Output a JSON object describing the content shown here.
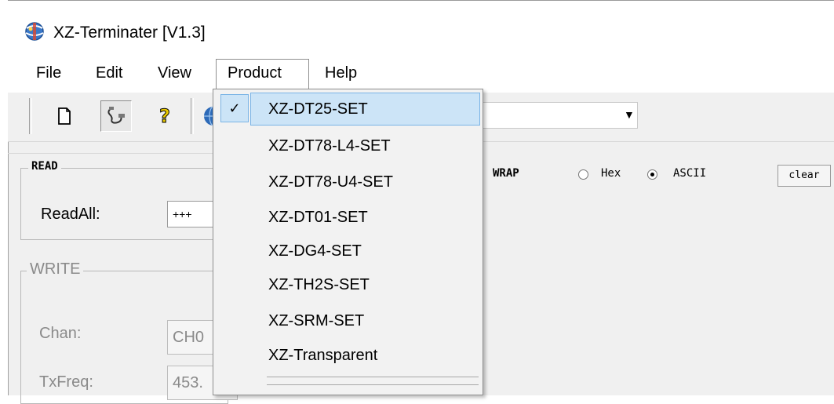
{
  "window": {
    "title": "XZ-Terminater [V1.3]"
  },
  "menubar": {
    "items": [
      {
        "label": "File"
      },
      {
        "label": "Edit"
      },
      {
        "label": "View"
      },
      {
        "label": "Product"
      },
      {
        "label": "Help"
      }
    ],
    "open_menu": "Product"
  },
  "toolbar": {
    "buttons": [
      {
        "icon": "new-document-icon"
      },
      {
        "icon": "connect-cable-icon",
        "pressed": true
      },
      {
        "icon": "help-question-icon"
      },
      {
        "icon": "globe-icon"
      }
    ]
  },
  "product_menu": {
    "items": [
      {
        "label": "XZ-DT25-SET",
        "checked": true
      },
      {
        "label": "XZ-DT78-L4-SET",
        "checked": false
      },
      {
        "label": "XZ-DT78-U4-SET",
        "checked": false
      },
      {
        "label": "XZ-DT01-SET",
        "checked": false
      },
      {
        "label": "XZ-DG4-SET",
        "checked": false
      },
      {
        "label": "XZ-TH2S-SET",
        "checked": false
      },
      {
        "label": "XZ-SRM-SET",
        "checked": false
      },
      {
        "label": "XZ-Transparent",
        "checked": false
      }
    ],
    "check_glyph": "✓"
  },
  "read_group": {
    "legend": "READ",
    "readall_label": "ReadAll:",
    "readall_value": "+++"
  },
  "write_group": {
    "legend": "WRITE",
    "chan_label": "Chan:",
    "chan_value": "CH0",
    "txfreq_label": "TxFreq:",
    "txfreq_value": "453."
  },
  "receive_options": {
    "wrap_label": "WRAP",
    "hex_label": "Hex",
    "ascii_label": "ASCII",
    "selected": "ASCII",
    "clear_label": "clear"
  },
  "colors": {
    "menu_highlight": "#cce4f7",
    "menu_highlight_border": "#7ab4e6",
    "window_bg": "#f0f0f0"
  }
}
